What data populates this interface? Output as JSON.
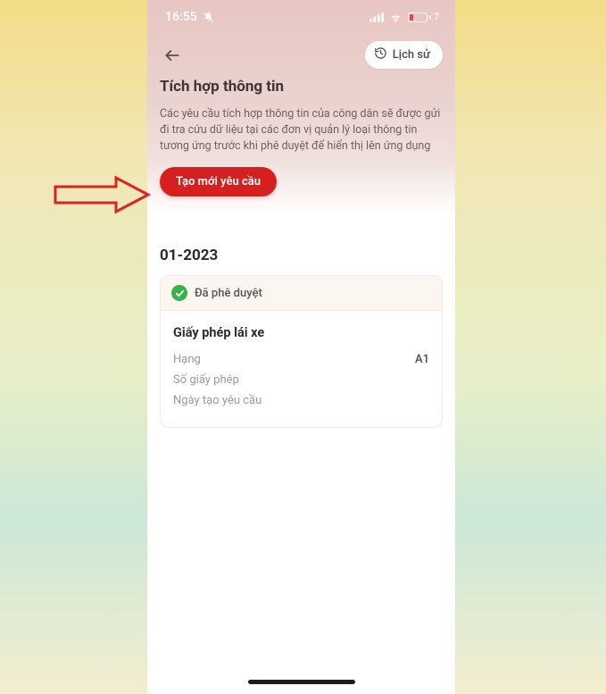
{
  "status_bar": {
    "time": "16:55",
    "battery_text": "7"
  },
  "nav": {
    "history_label": "Lịch sử"
  },
  "page": {
    "title": "Tích hợp thông tin",
    "description": "Các yêu cầu tích hợp thông tin của công dân sẽ được gửi đi tra cứu dữ liệu tại các đơn vị quản lý loại thông tin tương ứng trước khi phê duyệt để hiển thị lên ứng dụng",
    "create_label": "Tạo mới yêu cầu"
  },
  "section": {
    "label": "01-2023"
  },
  "card": {
    "status": "Đã phê duyệt",
    "title": "Giấy phép lái xe",
    "rows": [
      {
        "label": "Hạng",
        "value": "A1"
      },
      {
        "label": "Số giấy phép",
        "value": ""
      },
      {
        "label": "Ngày tạo yêu cầu",
        "value": ""
      }
    ]
  },
  "colors": {
    "primary_red": "#d5201f",
    "approved_green": "#38b24a"
  }
}
